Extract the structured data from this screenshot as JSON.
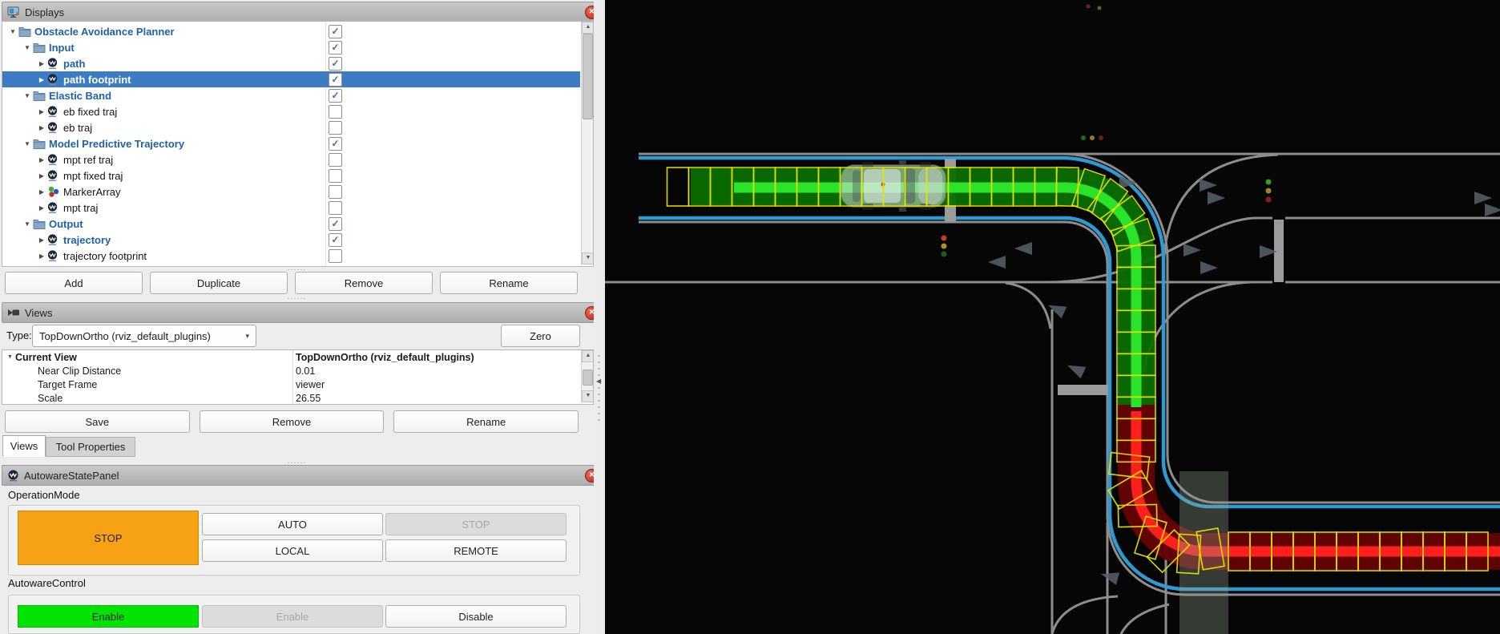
{
  "icons": {
    "close": "✕",
    "dropdown_arrow": "▾",
    "expand_open": "▼",
    "expand_closed": "▶",
    "checkmark": "✓",
    "splitter_dots": "······",
    "collapse_left": "◀",
    "scroll_up": "▲",
    "scroll_down": "▼"
  },
  "colors": {
    "selection_blue": "#3b7cc2",
    "tree_item_blue": "#2061a8",
    "check_blue": "#3571b8",
    "close_red": "#cf3f2f",
    "stop_orange": "#f7a114",
    "enable_green": "#00e400",
    "lane_blue": "#2f9ad2",
    "road_gray": "#8d8d8d",
    "path_green_dark": "#0b6e00",
    "trajectory_green": "#2ce32c",
    "path_red_dark": "#640300",
    "trajectory_red": "#ff1f1f",
    "footprint_yellow": "#e3e300"
  },
  "displays_panel": {
    "title": "Displays",
    "tree": [
      {
        "label": "Obstacle Avoidance Planner",
        "level": 0,
        "icon": "folder",
        "checked": true,
        "bold": true,
        "selected": false
      },
      {
        "label": "Input",
        "level": 1,
        "icon": "folder",
        "checked": true,
        "bold": true,
        "selected": false
      },
      {
        "label": "path",
        "level": 2,
        "icon": "display",
        "checked": true,
        "bold": true,
        "selected": false
      },
      {
        "label": "path footprint",
        "level": 2,
        "icon": "display",
        "checked": true,
        "bold": true,
        "selected": true
      },
      {
        "label": "Elastic Band",
        "level": 1,
        "icon": "folder",
        "checked": true,
        "bold": true,
        "selected": false
      },
      {
        "label": "eb fixed traj",
        "level": 2,
        "icon": "display",
        "checked": false,
        "bold": false,
        "selected": false
      },
      {
        "label": "eb traj",
        "level": 2,
        "icon": "display",
        "checked": false,
        "bold": false,
        "selected": false
      },
      {
        "label": "Model Predictive Trajectory",
        "level": 1,
        "icon": "folder",
        "checked": true,
        "bold": true,
        "selected": false
      },
      {
        "label": "mpt ref traj",
        "level": 2,
        "icon": "display",
        "checked": false,
        "bold": false,
        "selected": false
      },
      {
        "label": "mpt fixed traj",
        "level": 2,
        "icon": "display",
        "checked": false,
        "bold": false,
        "selected": false
      },
      {
        "label": "MarkerArray",
        "level": 2,
        "icon": "markers",
        "checked": false,
        "bold": false,
        "selected": false
      },
      {
        "label": "mpt traj",
        "level": 2,
        "icon": "display",
        "checked": false,
        "bold": false,
        "selected": false
      },
      {
        "label": "Output",
        "level": 1,
        "icon": "folder",
        "checked": true,
        "bold": true,
        "selected": false
      },
      {
        "label": "trajectory",
        "level": 2,
        "icon": "display",
        "checked": true,
        "bold": true,
        "selected": false
      },
      {
        "label": "trajectory footprint",
        "level": 2,
        "icon": "display",
        "checked": false,
        "bold": false,
        "selected": false
      }
    ],
    "buttons": [
      "Add",
      "Duplicate",
      "Remove",
      "Rename"
    ]
  },
  "views_panel": {
    "title": "Views",
    "type_label": "Type:",
    "type_value": "TopDownOrtho (rviz_default_plugins)",
    "zero_button": "Zero",
    "properties": [
      {
        "name": "Current View",
        "value": "TopDownOrtho (rviz_default_plugins)",
        "bold": true,
        "indent": 0
      },
      {
        "name": "Near Clip Distance",
        "value": "0.01",
        "bold": false,
        "indent": 1
      },
      {
        "name": "Target Frame",
        "value": "viewer",
        "bold": false,
        "indent": 1
      },
      {
        "name": "Scale",
        "value": "26.55",
        "bold": false,
        "indent": 1
      }
    ],
    "buttons": [
      "Save",
      "Remove",
      "Rename"
    ],
    "tabs": [
      {
        "label": "Views",
        "active": true
      },
      {
        "label": "Tool Properties",
        "active": false
      }
    ]
  },
  "state_panel": {
    "title": "AutowareStatePanel",
    "operation_mode": {
      "label": "OperationMode",
      "state_button": "STOP",
      "auto": "AUTO",
      "stop": "STOP",
      "local": "LOCAL",
      "remote": "REMOTE"
    },
    "autoware_control": {
      "label": "AutowareControl",
      "state_button": "Enable",
      "enable": "Enable",
      "disable": "Disable"
    }
  }
}
